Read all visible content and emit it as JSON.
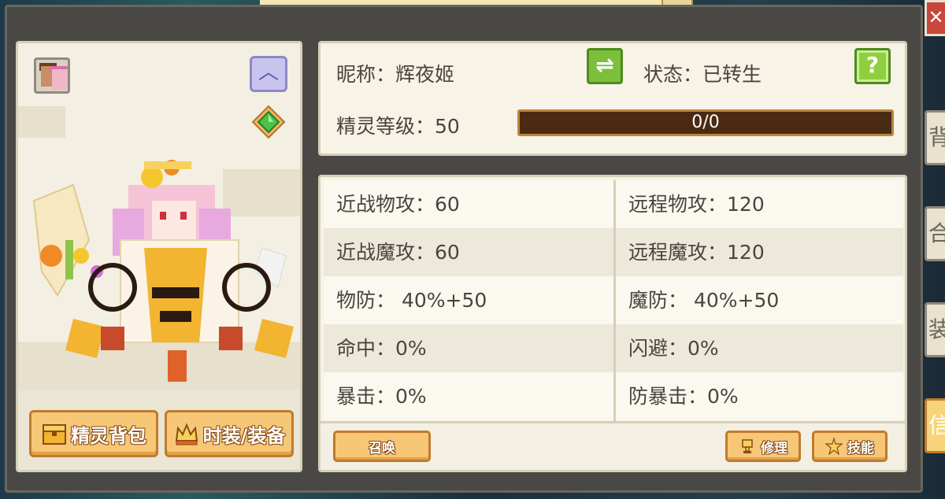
{
  "info": {
    "nickname_label": "昵称：",
    "nickname": "辉夜姬",
    "status_label": "状态：",
    "status": "已转生",
    "level_label": "精灵等级：",
    "level": "50",
    "exp_text": "0/0",
    "exp_progress": 0
  },
  "stats": {
    "left": [
      {
        "label": "近战物攻：",
        "value": "60"
      },
      {
        "label": "近战魔攻：",
        "value": "60"
      },
      {
        "label": "物防：",
        "value": " 40%+50"
      },
      {
        "label": "命中：",
        "value": "0%"
      },
      {
        "label": "暴击：",
        "value": "0%"
      }
    ],
    "right": [
      {
        "label": "远程物攻：",
        "value": "120"
      },
      {
        "label": "远程魔攻：",
        "value": "120"
      },
      {
        "label": "魔防：",
        "value": " 40%+50"
      },
      {
        "label": "闪避：",
        "value": "0%"
      },
      {
        "label": "防暴击：",
        "value": "0%"
      }
    ]
  },
  "buttons": {
    "spirit_bag": "精灵背包",
    "fashion_equip": "时装/装备",
    "summon": "召唤",
    "repair": "修理",
    "skills": "技能"
  },
  "side_tabs": [
    "背",
    "合",
    "装",
    "信"
  ],
  "colors": {
    "accent_orange": "#f6c777",
    "accent_green": "#7bbf3a",
    "panel_bg": "#f7f3e6",
    "exp_bar_bg": "#4a2a12"
  },
  "icons": {
    "close": "close-icon",
    "mood": "smile-icon",
    "gem": "green-gem-icon",
    "swap": "swap-arrows-icon",
    "help": "question-mark-icon"
  }
}
